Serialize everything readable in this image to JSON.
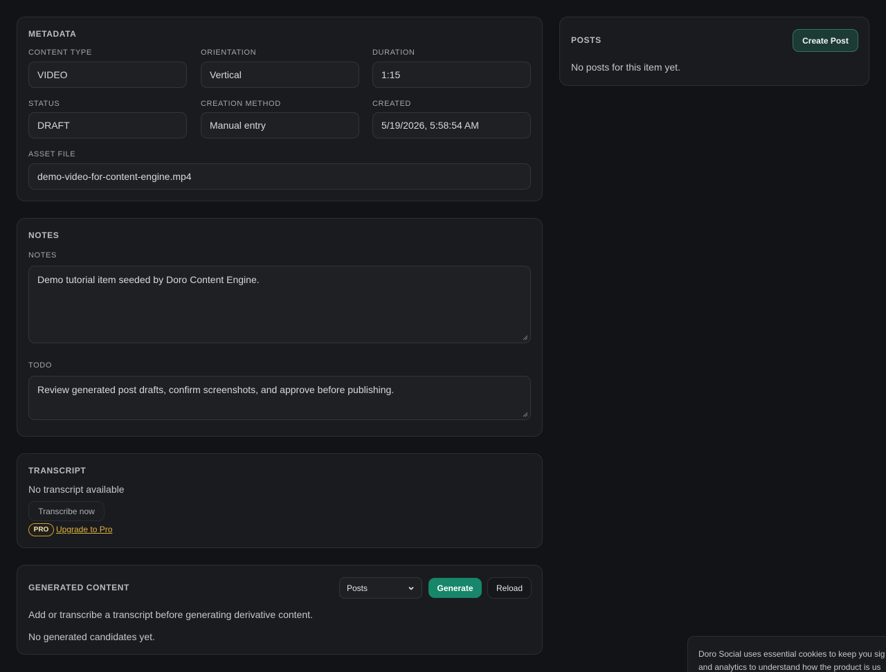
{
  "metadata": {
    "title": "METADATA",
    "fields": [
      {
        "label": "CONTENT TYPE",
        "value": "VIDEO"
      },
      {
        "label": "ORIENTATION",
        "value": "Vertical"
      },
      {
        "label": "DURATION",
        "value": "1:15"
      },
      {
        "label": "STATUS",
        "value": "DRAFT"
      },
      {
        "label": "CREATION METHOD",
        "value": "Manual entry"
      },
      {
        "label": "CREATED",
        "value": "5/19/2026, 5:58:54 AM"
      }
    ],
    "asset_file": {
      "label": "ASSET FILE",
      "value": "demo-video-for-content-engine.mp4"
    }
  },
  "notes": {
    "title": "NOTES",
    "notes_label": "NOTES",
    "notes_value": "Demo tutorial item seeded by Doro Content Engine.",
    "todo_label": "TODO",
    "todo_value": "Review generated post drafts, confirm screenshots, and approve before publishing."
  },
  "transcript": {
    "title": "TRANSCRIPT",
    "status": "No transcript available",
    "transcribe_label": "Transcribe now",
    "pro_badge": "PRO",
    "upgrade_label": "Upgrade to Pro"
  },
  "generated": {
    "title": "GENERATED CONTENT",
    "select_value": "Posts",
    "generate_label": "Generate",
    "reload_label": "Reload",
    "hint": "Add or transcribe a transcript before generating derivative content.",
    "empty": "No generated candidates yet."
  },
  "posts": {
    "title": "POSTS",
    "create_label": "Create Post",
    "empty": "No posts for this item yet."
  },
  "cookie": {
    "line1": "Doro Social uses essential cookies to keep you sig",
    "line2": "and analytics to understand how the product is us"
  },
  "colors": {
    "background": "#121316",
    "card": "#1a1b1f",
    "accent_green": "#17866a",
    "pro_gold": "#e2b33c"
  }
}
